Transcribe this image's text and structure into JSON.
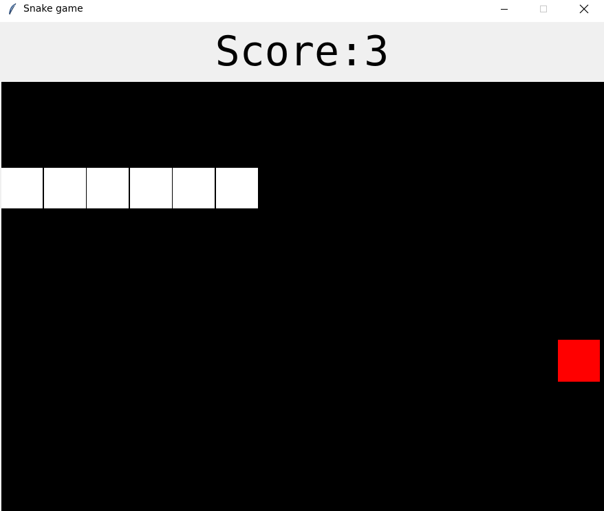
{
  "window": {
    "title": "Snake game",
    "icon": "feather-icon"
  },
  "controls": {
    "minimize": "minimize-icon",
    "maximize": "maximize-icon",
    "close": "close-icon"
  },
  "score": {
    "label": "Score:3",
    "value": 3
  },
  "game": {
    "grid_unit": "cell",
    "snake_color": "#FFFFFF",
    "snake_outline": "#000000",
    "food_color": "#FF0000",
    "background_color": "#000000",
    "snake_length": 6,
    "snake_cells": [
      [
        0,
        2
      ],
      [
        1,
        2
      ],
      [
        2,
        2
      ],
      [
        3,
        2
      ],
      [
        4,
        2
      ],
      [
        5,
        2
      ]
    ],
    "food_cell": [
      13,
      6
    ]
  }
}
